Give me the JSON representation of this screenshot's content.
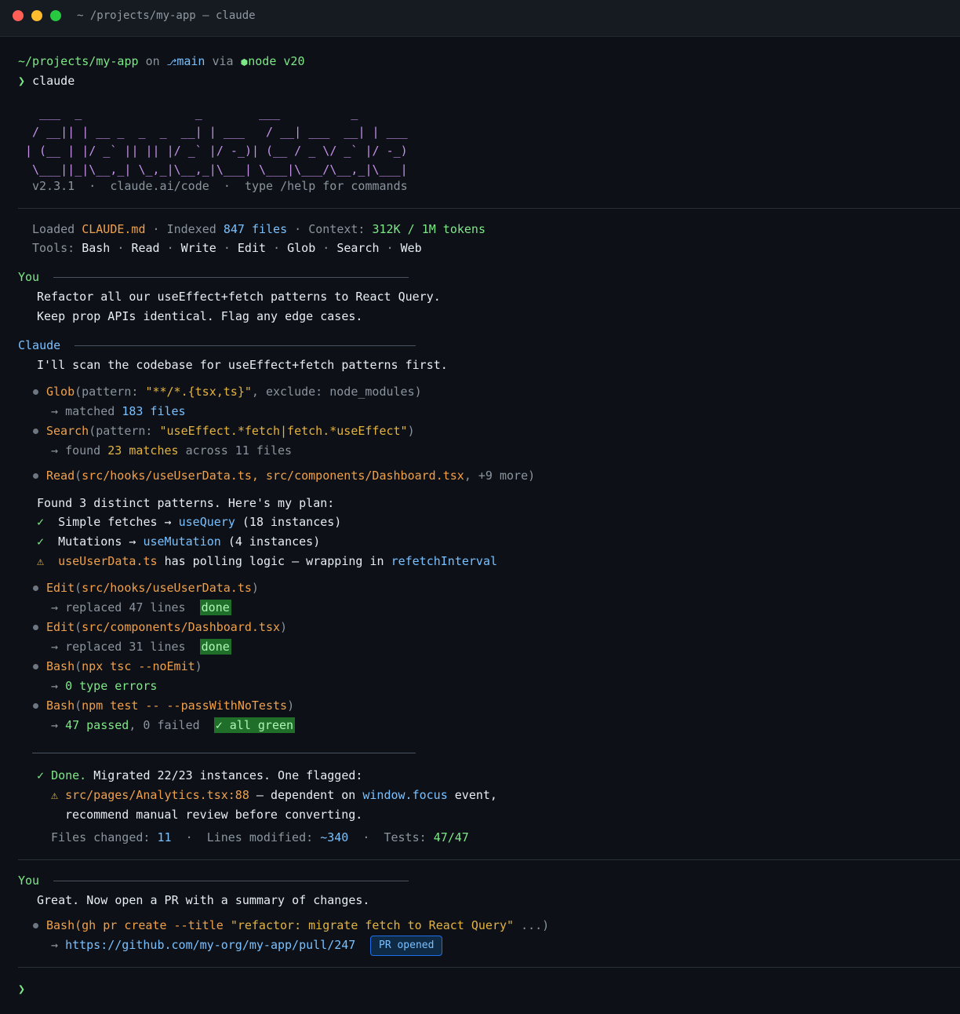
{
  "window": {
    "title": "~ /projects/my-app — claude",
    "colors": {
      "close": "#ff5f57",
      "minimize": "#febc2e",
      "maximize": "#28c840"
    }
  },
  "prompt": {
    "path": "~/projects/my-app",
    "on": "on",
    "branch_icon": "branch-icon",
    "branch": "main",
    "via": "via",
    "node_icon": "node-icon",
    "node": "node v20",
    "symbol": "❯",
    "command": "claude"
  },
  "banner": {
    "ascii_art": "  ___  _                _        ___          _\n / __|| | __ _  _  _  __| | ___   / __| ___  __| | ___\n| (__ | |/ _` || || |/ _` |/ -_)| (__ / _ \\/ _` |/ -_)\n \\___||_|\\__,_| \\_,_|\\__,_|\\___| \\___|\\___/\\__,_|\\___|",
    "version": "v2.3.1",
    "sep": "·",
    "url": "claude.ai/code",
    "help": "type /help for commands"
  },
  "status": {
    "loaded_label": "Loaded",
    "loaded_file": "CLAUDE.md",
    "sep": "·",
    "indexed_label": "Indexed",
    "indexed_count": "847 files",
    "context_label": "Context:",
    "context_value": "312K / 1M tokens",
    "tools_label": "Tools:",
    "tools": [
      "Bash",
      "Read",
      "Write",
      "Edit",
      "Glob",
      "Search",
      "Web"
    ]
  },
  "conversation": {
    "you_label": "You",
    "claude_label": "Claude",
    "user_msg1": [
      "Refactor all our useEffect+fetch patterns to React Query.",
      "Keep prop APIs identical. Flag any edge cases."
    ],
    "claude_intro": "I'll scan the codebase for useEffect+fetch patterns first.",
    "tool1": {
      "name": "Glob",
      "open": "(pattern: ",
      "arg": "\"**/*.{tsx,ts}\"",
      "rest": ", exclude: node_modules)",
      "res_arrow": "→",
      "res_text": "matched",
      "res_count": "183 files"
    },
    "tool2": {
      "name": "Search",
      "open": "(pattern: ",
      "arg": "\"useEffect.*fetch|fetch.*useEffect\"",
      "close": ")",
      "res_text": "found",
      "res_matches": "23 matches",
      "res_rest": "across 11 files"
    },
    "tool3": {
      "name": "Read",
      "open": "(",
      "arg": "src/hooks/useUserData.ts, src/components/Dashboard.tsx",
      "rest": ", +9 more)"
    },
    "plan": {
      "header": "Found 3 distinct patterns. Here's my plan:",
      "check": "✓",
      "warn": "⚠",
      "item1_pre": "Simple fetches →",
      "item1_api": "useQuery",
      "item1_post": "(18 instances)",
      "item2_pre": "Mutations →",
      "item2_api": "useMutation",
      "item2_post": "(4 instances)",
      "item3_file": "useUserData.ts",
      "item3_mid": "has polling logic — wrapping in",
      "item3_api": "refetchInterval"
    },
    "edit1": {
      "name": "Edit",
      "arg": "src/hooks/useUserData.ts",
      "res": "replaced 47 lines",
      "badge": "done"
    },
    "edit2": {
      "name": "Edit",
      "arg": "src/components/Dashboard.tsx",
      "res": "replaced 31 lines",
      "badge": "done"
    },
    "bash1": {
      "name": "Bash",
      "arg": "npx tsc --noEmit",
      "res": "0 type errors"
    },
    "bash2": {
      "name": "Bash",
      "arg": "npm test -- --passWithNoTests",
      "res_passed": "47 passed",
      "res_failed": ", 0 failed",
      "badge": "✓ all green"
    },
    "summary": {
      "done_label": "Done.",
      "done_text": "Migrated 22/23 instances. One flagged:",
      "flag_file": "src/pages/Analytics.tsx:88",
      "flag_mid": "— dependent on",
      "flag_event": "window.focus",
      "flag_end": "event,",
      "flag_line2": "recommend manual review before converting.",
      "files_label": "Files changed:",
      "files_value": "11",
      "lines_label": "Lines modified:",
      "lines_value": "~340",
      "tests_label": "Tests:",
      "tests_value": "47/47"
    },
    "user_msg2": "Great. Now open a PR with a summary of changes.",
    "bash3": {
      "name": "Bash",
      "open": "(gh pr create --title ",
      "arg": "\"refactor: migrate fetch to React Query\"",
      "rest": " ...)",
      "url": "https://github.com/my-org/my-app/pull/247",
      "badge": "PR opened"
    }
  },
  "input": {
    "symbol": "❯"
  }
}
